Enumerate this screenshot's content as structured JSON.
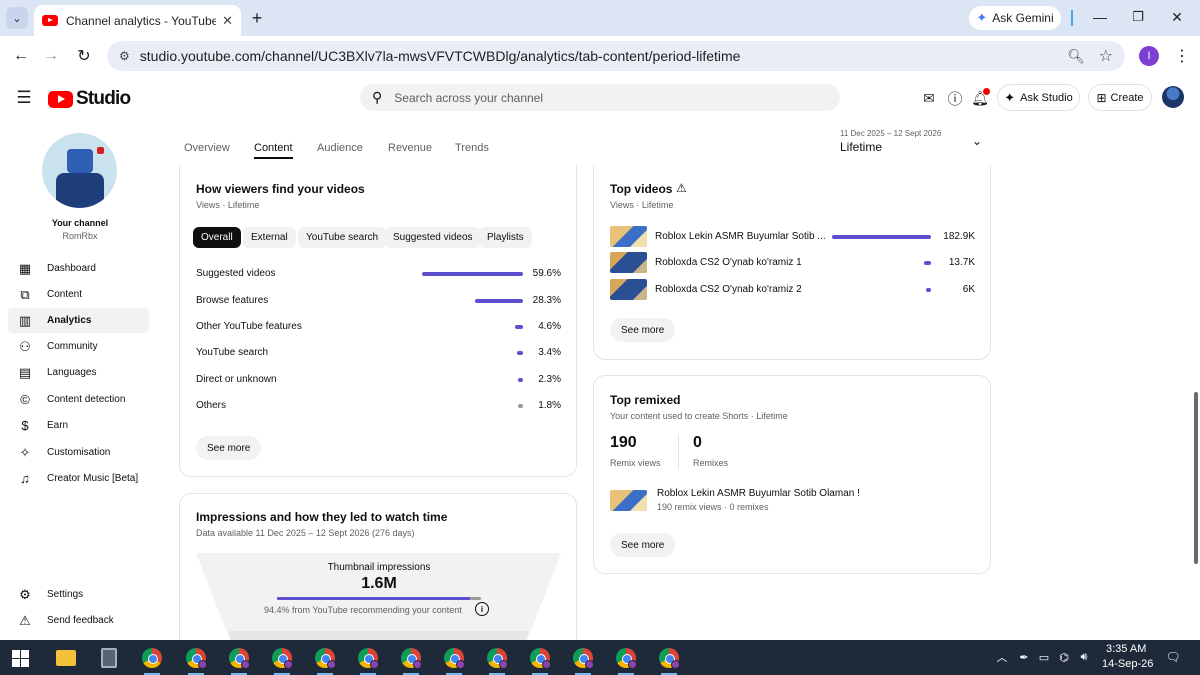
{
  "browser": {
    "tab_title": "Channel analytics - YouTube Stu",
    "tab_close": "✕",
    "new_tab": "+",
    "ask_gemini": "Ask Gemini",
    "url": "studio.youtube.com/channel/UC3BXlv7la-mwsVFVTCWBDlg/analytics/tab-content/period-lifetime",
    "profile_initial": "I"
  },
  "studio": {
    "logo_text": "Studio",
    "search_placeholder": "Search across your channel",
    "ask_studio": "Ask Studio",
    "create": "Create"
  },
  "sidebar": {
    "your_channel": "Your channel",
    "channel_name": "RomRbx",
    "items": [
      {
        "label": "Dashboard",
        "icon": "dashboard-icon"
      },
      {
        "label": "Content",
        "icon": "content-icon"
      },
      {
        "label": "Analytics",
        "icon": "analytics-icon",
        "active": true
      },
      {
        "label": "Community",
        "icon": "community-icon"
      },
      {
        "label": "Languages",
        "icon": "languages-icon"
      },
      {
        "label": "Content detection",
        "icon": "copyright-icon"
      },
      {
        "label": "Earn",
        "icon": "dollar-icon"
      },
      {
        "label": "Customisation",
        "icon": "magic-wand-icon"
      },
      {
        "label": "Creator Music [Beta]",
        "icon": "music-icon"
      }
    ],
    "settings": "Settings",
    "send_feedback": "Send feedback"
  },
  "tabs": [
    "Overview",
    "Content",
    "Audience",
    "Revenue",
    "Trends"
  ],
  "active_tab": "Content",
  "period": {
    "range": "11 Dec 2025 – 12 Sept 2026",
    "value": "Lifetime"
  },
  "traffic": {
    "title": "How viewers find your videos",
    "subtitle": "Views · Lifetime",
    "chips": [
      "Overall",
      "External",
      "YouTube search",
      "Suggested videos",
      "Playlists"
    ],
    "active_chip": "Overall",
    "rows": [
      {
        "label": "Suggested videos",
        "value": "59.6%",
        "share": 59.6
      },
      {
        "label": "Browse features",
        "value": "28.3%",
        "share": 28.3
      },
      {
        "label": "Other YouTube features",
        "value": "4.6%",
        "share": 4.6
      },
      {
        "label": "YouTube search",
        "value": "3.4%",
        "share": 3.4
      },
      {
        "label": "Direct or unknown",
        "value": "2.3%",
        "share": 2.3
      },
      {
        "label": "Others",
        "value": "1.8%",
        "share": 1.8
      }
    ],
    "see_more": "See more"
  },
  "impressions": {
    "title": "Impressions and how they led to watch time",
    "subtitle": "Data available 11 Dec 2025 – 12 Sept 2026 (276 days)",
    "thumb_label": "Thumbnail impressions",
    "thumb_value": "1.6M",
    "recommend_share": 94.4,
    "note": "94.4% from YouTube recommending your content",
    "info": "i"
  },
  "top_videos": {
    "title": "Top videos",
    "warning": "⚠",
    "subtitle": "Views · Lifetime",
    "rows": [
      {
        "title": "Roblox Lekin ASMR Buyumlar Sotib ...",
        "value": "182.9K",
        "views": 182900
      },
      {
        "title": "Robloxda CS2 O'ynab ko'ramiz 1",
        "value": "13.7K",
        "views": 13700
      },
      {
        "title": "Robloxda CS2 O'ynab ko'ramiz 2",
        "value": "6K",
        "views": 6000
      }
    ],
    "see_more": "See more"
  },
  "top_remixed": {
    "title": "Top remixed",
    "subtitle": "Your content used to create Shorts · Lifetime",
    "remix_views": "190",
    "remix_views_label": "Remix views",
    "remixes": "0",
    "remixes_label": "Remixes",
    "video_title": "Roblox Lekin ASMR Buyumlar Sotib Olaman !",
    "video_meta": "190 remix views · 0 remixes",
    "see_more": "See more"
  },
  "taskbar": {
    "time": "3:35 AM",
    "date": "14-Sep-26"
  },
  "colors": {
    "accent_bar": "#5c4fd0",
    "youtube_red": "#ff0000",
    "chrome_frame": "#dbe5f4"
  }
}
